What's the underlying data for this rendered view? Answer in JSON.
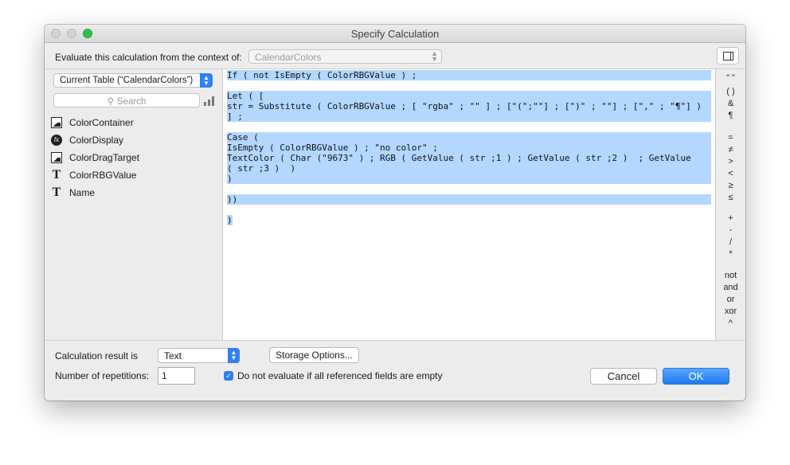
{
  "window": {
    "title": "Specify Calculation"
  },
  "context": {
    "label": "Evaluate this calculation from the context of:",
    "value": "CalendarColors"
  },
  "left": {
    "table_select": "Current Table (“CalendarColors”)",
    "search_placeholder": "Search",
    "fields": [
      {
        "label": "ColorContainer",
        "icon": "container-field-icon"
      },
      {
        "label": "ColorDisplay",
        "icon": "calculation-field-icon"
      },
      {
        "label": "ColorDragTarget",
        "icon": "container-field-icon"
      },
      {
        "label": "ColorRBGValue",
        "icon": "text-field-icon"
      },
      {
        "label": "Name",
        "icon": "text-field-icon"
      }
    ]
  },
  "editor": {
    "lines": [
      "If ( not IsEmpty ( ColorRBGValue ) ;",
      "",
      "Let ( [",
      "str = Substitute ( ColorRBGValue ; [ \"rgba\" ; \"\" ] ; [\"(\";\"\"] ; [\")\" ; \"\"] ; [\",\" ; \"¶\"] )",
      "] ;",
      "",
      "Case (",
      "IsEmpty ( ColorRBGValue ) ; \"no color\" ;",
      "TextColor ( Char (\"9673\" ) ; RGB ( GetValue ( str ;1 ) ; GetValue ( str ;2 )  ; GetValue",
      "( str ;3 )  )",
      ")",
      "",
      "))",
      "",
      ")"
    ]
  },
  "operators": [
    "\" \"",
    "( )",
    "&",
    "¶",
    "=",
    "≠",
    ">",
    "<",
    "≥",
    "≤",
    "+",
    "-",
    "/",
    "*",
    "not",
    "and",
    "or",
    "xor",
    "^"
  ],
  "bottom": {
    "result_label": "Calculation result is",
    "result_value": "Text",
    "storage_button": "Storage Options...",
    "repetitions_label": "Number of repetitions:",
    "repetitions_value": "1",
    "checkbox_label": "Do not evaluate if all referenced fields are empty",
    "cancel": "Cancel",
    "ok": "OK"
  }
}
